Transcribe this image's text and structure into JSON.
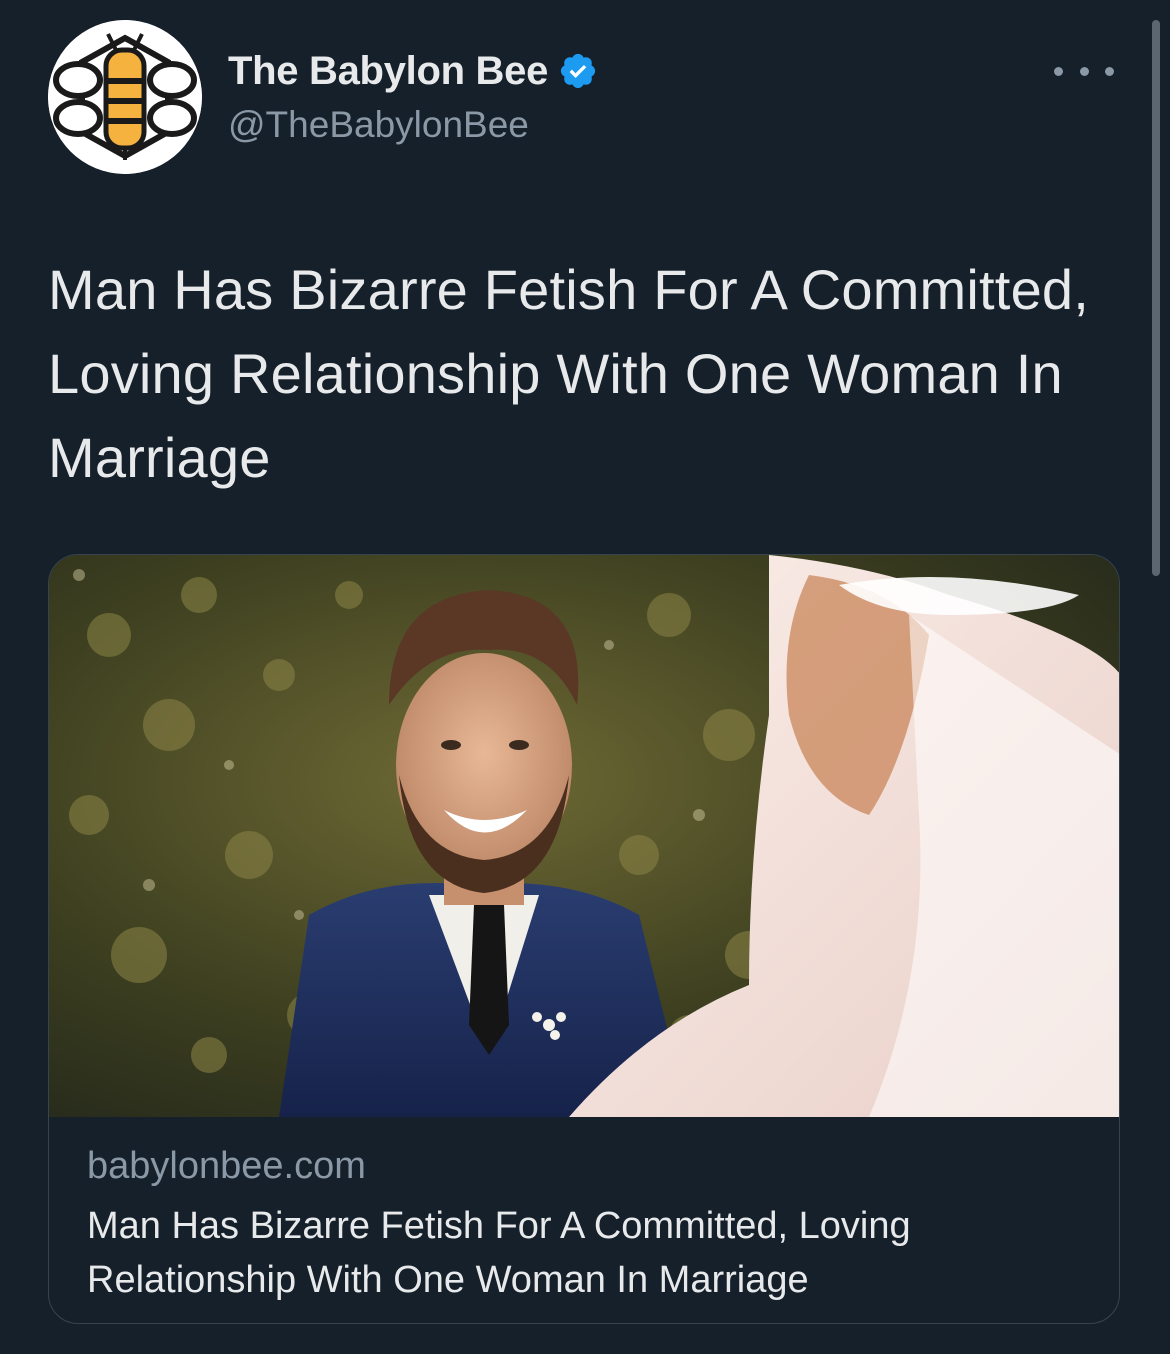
{
  "tweet": {
    "author": {
      "display_name": "The Babylon Bee",
      "handle": "@TheBabylonBee",
      "verified": true,
      "avatar_icon": "bee-logo-icon"
    },
    "more_icon": "ellipsis-icon",
    "text": "Man Has Bizarre Fetish For A Committed, Loving Relationship With One Woman In Marriage",
    "card": {
      "image_icon": "wedding-photo",
      "domain": "babylonbee.com",
      "title": "Man Has Bizarre Fetish For A Committed, Loving Relationship With One Woman In Marriage"
    }
  },
  "colors": {
    "background": "#15202b",
    "text_primary": "#e7e9ea",
    "text_secondary": "#8b98a5",
    "verified_blue": "#1d9bf0",
    "card_border": "#38444d",
    "bee_yellow": "#f6b23e"
  }
}
